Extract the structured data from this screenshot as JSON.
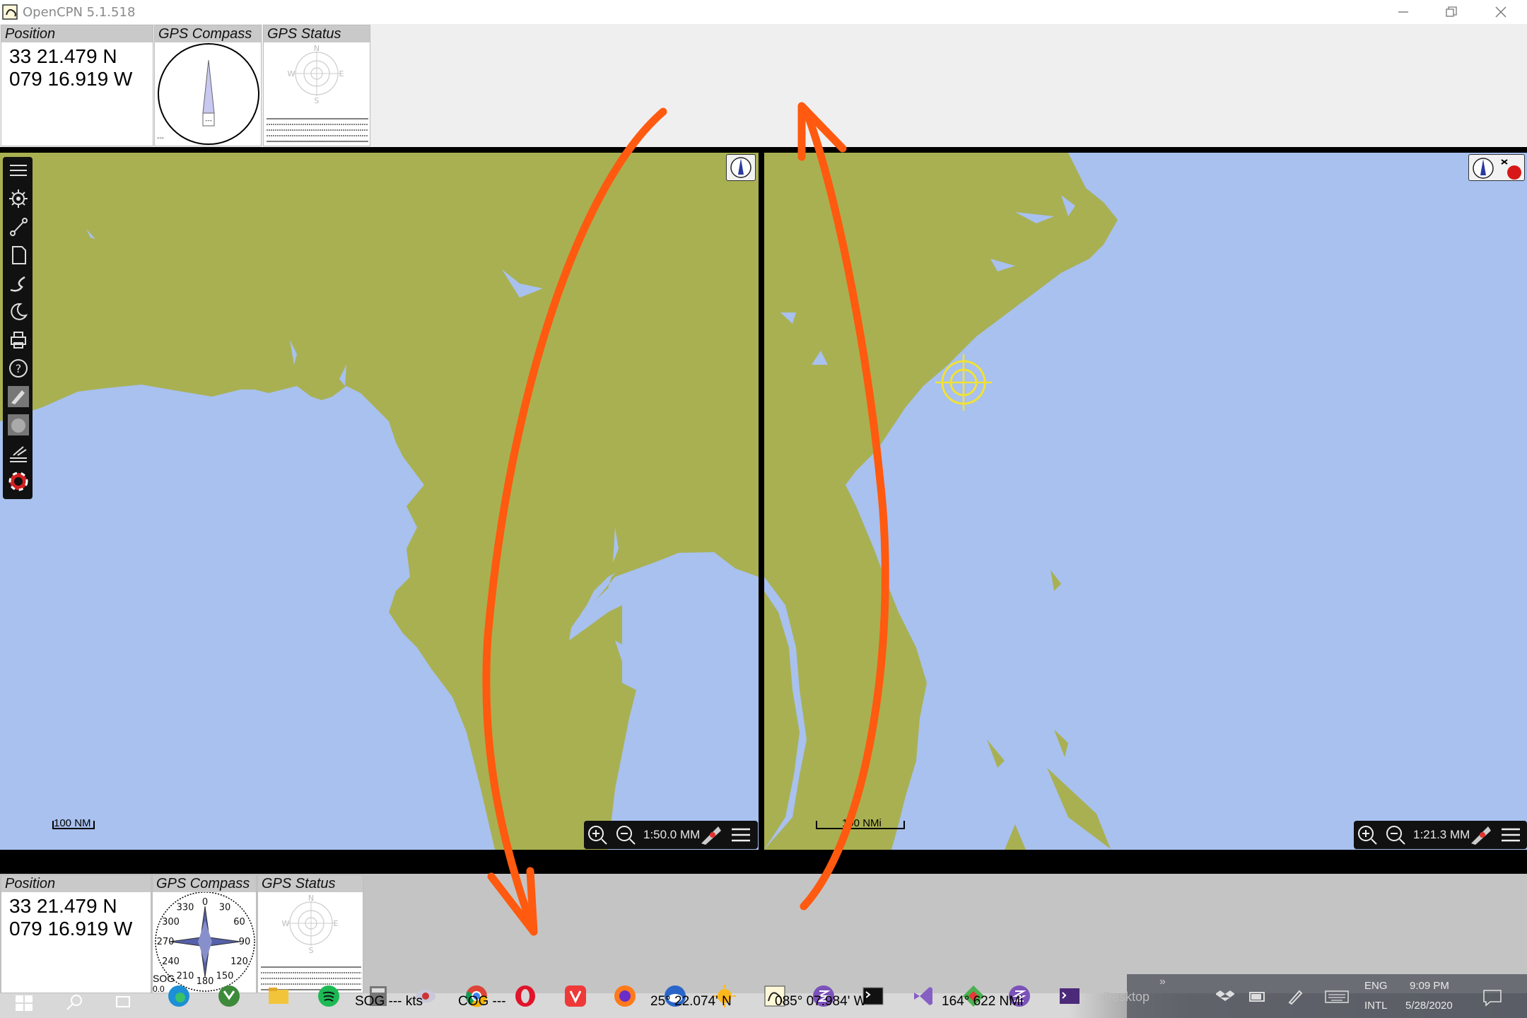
{
  "window": {
    "title": "OpenCPN 5.1.518",
    "minimize_icon": "minimize-icon",
    "restore_icon": "restore-icon",
    "close_icon": "close-icon"
  },
  "top_dashboard": {
    "position": {
      "header": "Position",
      "lat": "33 21.479 N",
      "lon": "079 16.919 W"
    },
    "compass": {
      "header": "GPS Compass",
      "footer": "---"
    },
    "gps_status": {
      "header": "GPS Status",
      "n": "N",
      "e": "E",
      "s": "S",
      "w": "W"
    }
  },
  "bottom_dashboard": {
    "position": {
      "header": "Position",
      "lat": "33 21.479 N",
      "lon": "079 16.919 W"
    },
    "compass": {
      "header": "GPS Compass",
      "sog_label": "SOG",
      "sog_value": "0.0",
      "rose_labels": [
        "0",
        "30",
        "60",
        "90",
        "120",
        "150",
        "180",
        "210",
        "240",
        "270",
        "300",
        "330"
      ]
    },
    "gps_status": {
      "header": "GPS Status",
      "n": "N",
      "e": "E",
      "s": "S",
      "w": "W"
    }
  },
  "left_chart": {
    "scale_bar": "100 NM",
    "zoom_scale": "1:50.0 MM",
    "land_color": "#a9b052",
    "water_color": "#a8c1ef"
  },
  "right_chart": {
    "scale_bar": "100 NMi",
    "zoom_scale": "1:21.3 MM",
    "ownship_color": "#f2e233"
  },
  "toolbar": {
    "tools": [
      "menu-icon",
      "settings-icon",
      "route-icon",
      "waypoint-manager-icon",
      "track-icon",
      "moon-icon",
      "print-icon",
      "help-icon",
      "ais-icon",
      "dashboard-icon",
      "tide-icon",
      "mob-icon"
    ]
  },
  "annotation": {
    "arrow_color": "#ff5a0f"
  },
  "taskbar": {
    "sog_text": "SOG --- kts",
    "cog_text": "COG ---",
    "lat_text": "25° 22.074' N",
    "lon_text": "085° 07.984' W",
    "range_text": "164° 622 NMi",
    "desktop_label": "Desktop",
    "lang": "ENG",
    "layout": "INTL",
    "time": "9:09 PM",
    "date": "5/28/2020"
  }
}
